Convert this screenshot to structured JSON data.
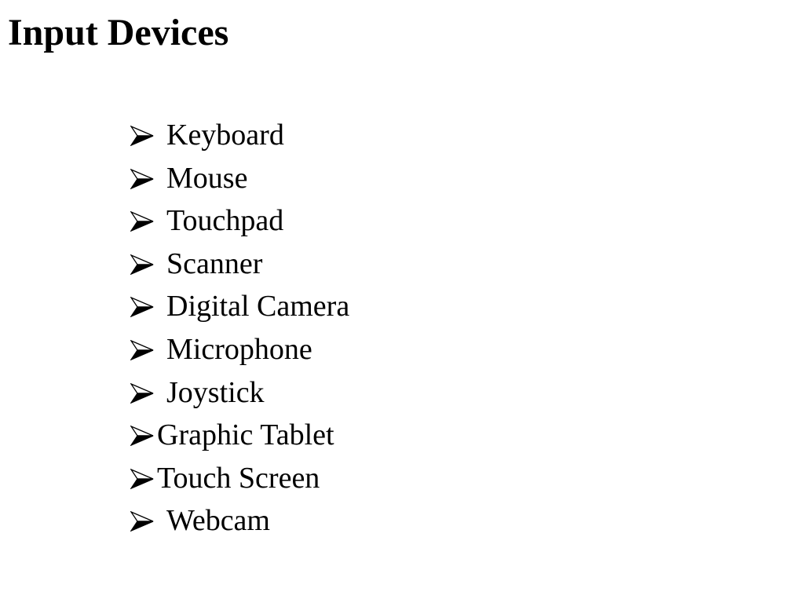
{
  "slide": {
    "title": "Input Devices",
    "bullet_icon": "arrowhead-bullet-icon",
    "items": [
      {
        "label": "Keyboard",
        "spaced": true
      },
      {
        "label": "Mouse",
        "spaced": true
      },
      {
        "label": "Touchpad",
        "spaced": true
      },
      {
        "label": "Scanner",
        "spaced": true
      },
      {
        "label": "Digital Camera",
        "spaced": true
      },
      {
        "label": "Microphone",
        "spaced": true
      },
      {
        "label": "Joystick",
        "spaced": true
      },
      {
        "label": "Graphic Tablet",
        "spaced": false
      },
      {
        "label": "Touch Screen",
        "spaced": false
      },
      {
        "label": "Webcam",
        "spaced": true
      }
    ]
  }
}
